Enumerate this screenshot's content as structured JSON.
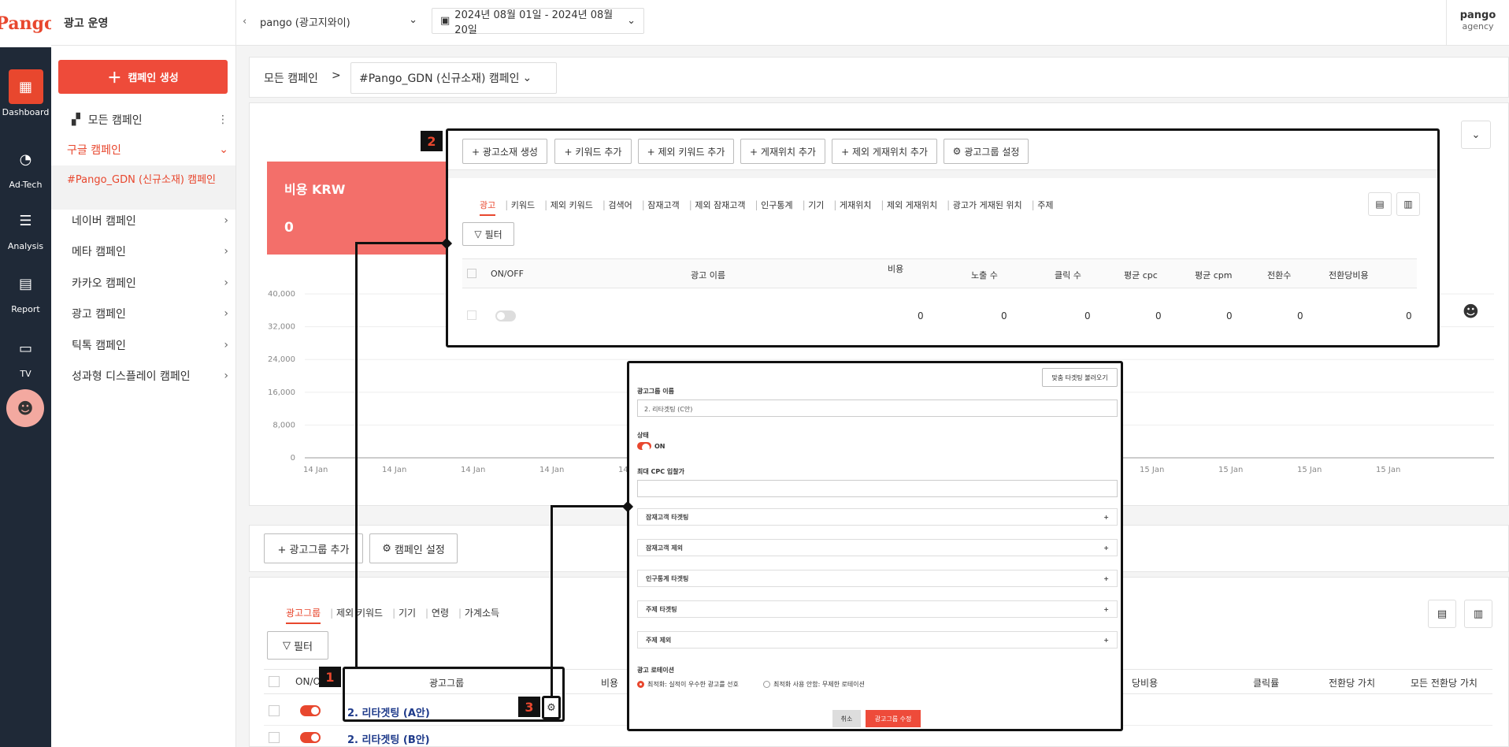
{
  "rail": {
    "logo": "Pango",
    "items": [
      {
        "label": "Dashboard",
        "icon": "dashboard-icon"
      },
      {
        "label": "Ad-Tech",
        "icon": "gauge-icon"
      },
      {
        "label": "Analysis",
        "icon": "sliders-icon"
      },
      {
        "label": "Report",
        "icon": "report-icon"
      },
      {
        "label": "TV",
        "icon": "tv-icon"
      }
    ]
  },
  "sidebar": {
    "title": "광고 운영",
    "create_label": "캠페인 생성",
    "all_campaigns": "모든 캠페인",
    "google": "구글 캠페인",
    "active_campaign": "#Pango_GDN (신규소재) 캠페인",
    "items": [
      "네이버 캠페인",
      "메타 캠페인",
      "카카오 캠페인",
      "광고 캠페인",
      "틱톡 캠페인",
      "성과형 디스플레이 캠페인"
    ]
  },
  "topbar": {
    "account": "pango (광고지와이)",
    "date_range": "2024년 08월 01일 - 2024년 08월 20일",
    "user_name": "pango",
    "user_role": "agency"
  },
  "breadcrumb": {
    "root": "모든 캠페인",
    "current": "#Pango_GDN (신규소재) 캠페인"
  },
  "kpi": {
    "label": "비용 KRW",
    "value": "0"
  },
  "chart_data": {
    "type": "line",
    "y_ticks": [
      "40,000",
      "32,000",
      "24,000",
      "16,000",
      "8,000",
      "0"
    ],
    "x_ticks": [
      "14 Jan",
      "14 Jan",
      "14 Jan",
      "14 Jan",
      "14 Jan",
      "15 Jan",
      "15 Jan",
      "15 Jan",
      "15 Jan"
    ],
    "ylim": [
      0,
      40000
    ]
  },
  "overlay2": {
    "badge": "2",
    "buttons": [
      "+ 광고소재 생성",
      "+ 키워드 추가",
      "+ 제외 키워드 추가",
      "+ 게재위치 추가",
      "+ 제외 게재위치 추가",
      "광고그룹 설정"
    ],
    "tabs": [
      "광고",
      "키워드",
      "제외 키워드",
      "검색어",
      "잠재고객",
      "제외 잠재고객",
      "인구통계",
      "기기",
      "게재위치",
      "제외 게재위치",
      "광고가 게재된 위치",
      "주제"
    ],
    "filter": "필터",
    "columns": [
      "ON/OFF",
      "광고 이름",
      "비용",
      "노출 수",
      "클릭 수",
      "평균 cpc",
      "평균 cpm",
      "전환수",
      "전환당비용"
    ],
    "row": [
      "0",
      "0",
      "0",
      "0",
      "0",
      "0",
      "0"
    ]
  },
  "lower": {
    "add_group": "+ 광고그룹 추가",
    "campaign_settings": "캠페인 설정",
    "tabs": [
      "광고그룹",
      "제외 키워드",
      "기기",
      "연령",
      "가계소득"
    ],
    "filter": "필터",
    "columns": [
      "ON/OFF",
      "광고그룹",
      "비용",
      "당비용",
      "클릭률",
      "전환당 가치",
      "모든 전환당 가치"
    ],
    "rows": [
      "2. 리타겟팅 (A안)",
      "2. 리타겟팅 (B안)"
    ],
    "badge1": "1",
    "badge3": "3"
  },
  "modal": {
    "load_btn": "맞춤 타겟팅 불러오기",
    "name_label": "광고그룹 이름",
    "name_value": "2. 리타겟팅 (C안)",
    "status_label": "상태",
    "status_value": "ON",
    "cpc_label": "최대 CPC 입찰가",
    "accordions": [
      "잠재고객 타겟팅",
      "잠재고객 제외",
      "인구통계 타겟팅",
      "주제 타겟팅",
      "주제 제외"
    ],
    "rotation_label": "광고 로테이션",
    "rotation_opts": [
      "최적화: 실적이 우수한 광고를 선호",
      "최적화 사용 안함: 무제한 로테이션"
    ],
    "cancel": "취소",
    "submit": "광고그룹 수정"
  }
}
